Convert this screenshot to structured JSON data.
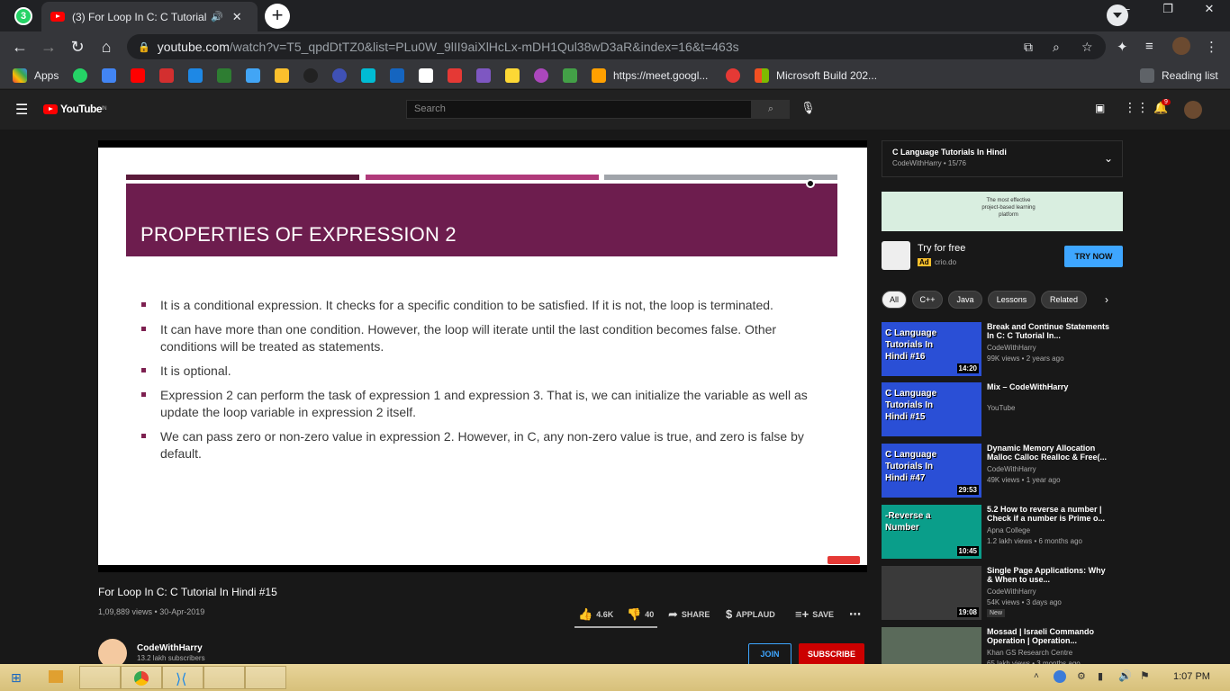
{
  "browser": {
    "whatsapp_badge": "3",
    "tab_title": "(3) For Loop In C: C Tutorial In Hindi #15",
    "new_tab": "+",
    "url_host": "youtube.com",
    "url_path": "/watch?v=T5_qpdDtTZ0&list=PLu0W_9lII9aiXlHcLx-mDH1Qul38wD3aR&index=16&t=463s",
    "bookmarks": {
      "apps": "Apps",
      "meet": "https://meet.googl...",
      "build": "Microsoft Build 202...",
      "reading_list": "Reading list"
    },
    "win_min": "–",
    "win_max": "❐",
    "win_close": "✕"
  },
  "youtube": {
    "logo": "YouTube",
    "logo_region": "IN",
    "search_placeholder": "Search",
    "notification_count": "9"
  },
  "slide": {
    "heading": "PROPERTIES OF EXPRESSION 2",
    "bullets": [
      "It is a conditional expression. It checks for a specific condition to be satisfied. If it is not, the loop is terminated.",
      "It can have more than one condition. However, the loop will iterate until the last condition becomes false. Other conditions will be treated as statements.",
      "It is optional.",
      "Expression 2 can perform the task of expression 1 and expression 3. That is, we can initialize the variable as well as update the loop variable in expression 2 itself.",
      "We can pass zero or non-zero value in expression 2. However, in C, any non-zero value is true, and zero is false by default."
    ],
    "bar_colors": [
      "#5a1a3a",
      "#b03a7a",
      "#a0a4aa"
    ],
    "banner_color": "#6d1d4e"
  },
  "video": {
    "title": "For Loop In C: C Tutorial In Hindi #15",
    "meta": "1,09,889 views • 30-Apr-2019",
    "likes": "4.6K",
    "dislikes": "40",
    "share": "SHARE",
    "applaud": "APPLAUD",
    "save": "SAVE",
    "channel": "CodeWithHarry",
    "subscribers": "13.2 lakh subscribers",
    "join": "JOIN",
    "subscribe": "SUBSCRIBE"
  },
  "playlist": {
    "title": "C Language Tutorials In Hindi",
    "meta": "CodeWithHarry • 15/76"
  },
  "ad": {
    "banner_text": "The most effective project-based learning platform",
    "try": "Try for free",
    "badge": "Ad",
    "domain": "crio.do",
    "cta": "TRY NOW"
  },
  "chips": [
    "All",
    "C++",
    "Java",
    "Lessons",
    "Related"
  ],
  "recommendations": [
    {
      "thumb_text": "C Language Tutorials In Hindi #16",
      "duration": "14:20",
      "title": "Break and Continue Statements In C: C Tutorial In...",
      "channel": "CodeWithHarry",
      "views": "99K views • 2 years ago",
      "bg": "#2a4fd6"
    },
    {
      "thumb_text": "C Language Tutorials In Hindi #15",
      "duration": "",
      "title": "Mix – CodeWithHarry",
      "channel": "YouTube",
      "views": "",
      "bg": "#2a4fd6"
    },
    {
      "thumb_text": "C Language Tutorials In Hindi #47",
      "duration": "29:53",
      "title": "Dynamic Memory Allocation Malloc Calloc Realloc & Free(...",
      "channel": "CodeWithHarry",
      "views": "49K views • 1 year ago",
      "bg": "#2a4fd6"
    },
    {
      "thumb_text": "-Reverse a Number",
      "duration": "10:45",
      "title": "5.2 How to reverse a number | Check if a number is Prime o...",
      "channel": "Apna College",
      "views": "1.2 lakh views • 6 months ago",
      "bg": "#0a9e8a"
    },
    {
      "thumb_text": "",
      "duration": "19:08",
      "title": "Single Page Applications: Why & When to use...",
      "channel": "CodeWithHarry",
      "views": "54K views • 3 days ago",
      "bg": "#3a3a3a",
      "new": "New"
    },
    {
      "thumb_text": "",
      "duration": "",
      "title": "Mossad | Israeli Commando Operation | Operation...",
      "channel": "Khan GS Research Centre",
      "views": "65 lakh views • 3 months ago",
      "bg": "#5a6a5a"
    }
  ],
  "taskbar": {
    "clock": "1:07 PM"
  }
}
